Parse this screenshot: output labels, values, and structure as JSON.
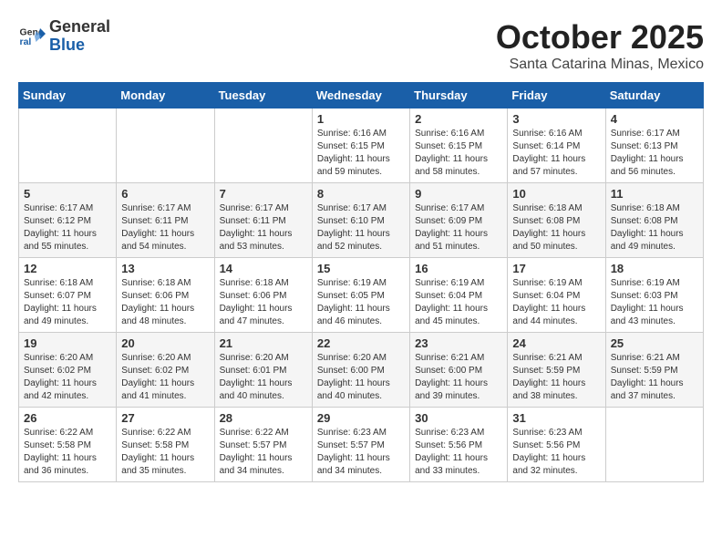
{
  "header": {
    "logo_general": "General",
    "logo_blue": "Blue",
    "month_title": "October 2025",
    "subtitle": "Santa Catarina Minas, Mexico"
  },
  "weekdays": [
    "Sunday",
    "Monday",
    "Tuesday",
    "Wednesday",
    "Thursday",
    "Friday",
    "Saturday"
  ],
  "weeks": [
    [
      {
        "day": "",
        "info": ""
      },
      {
        "day": "",
        "info": ""
      },
      {
        "day": "",
        "info": ""
      },
      {
        "day": "1",
        "info": "Sunrise: 6:16 AM\nSunset: 6:15 PM\nDaylight: 11 hours\nand 59 minutes."
      },
      {
        "day": "2",
        "info": "Sunrise: 6:16 AM\nSunset: 6:15 PM\nDaylight: 11 hours\nand 58 minutes."
      },
      {
        "day": "3",
        "info": "Sunrise: 6:16 AM\nSunset: 6:14 PM\nDaylight: 11 hours\nand 57 minutes."
      },
      {
        "day": "4",
        "info": "Sunrise: 6:17 AM\nSunset: 6:13 PM\nDaylight: 11 hours\nand 56 minutes."
      }
    ],
    [
      {
        "day": "5",
        "info": "Sunrise: 6:17 AM\nSunset: 6:12 PM\nDaylight: 11 hours\nand 55 minutes."
      },
      {
        "day": "6",
        "info": "Sunrise: 6:17 AM\nSunset: 6:11 PM\nDaylight: 11 hours\nand 54 minutes."
      },
      {
        "day": "7",
        "info": "Sunrise: 6:17 AM\nSunset: 6:11 PM\nDaylight: 11 hours\nand 53 minutes."
      },
      {
        "day": "8",
        "info": "Sunrise: 6:17 AM\nSunset: 6:10 PM\nDaylight: 11 hours\nand 52 minutes."
      },
      {
        "day": "9",
        "info": "Sunrise: 6:17 AM\nSunset: 6:09 PM\nDaylight: 11 hours\nand 51 minutes."
      },
      {
        "day": "10",
        "info": "Sunrise: 6:18 AM\nSunset: 6:08 PM\nDaylight: 11 hours\nand 50 minutes."
      },
      {
        "day": "11",
        "info": "Sunrise: 6:18 AM\nSunset: 6:08 PM\nDaylight: 11 hours\nand 49 minutes."
      }
    ],
    [
      {
        "day": "12",
        "info": "Sunrise: 6:18 AM\nSunset: 6:07 PM\nDaylight: 11 hours\nand 49 minutes."
      },
      {
        "day": "13",
        "info": "Sunrise: 6:18 AM\nSunset: 6:06 PM\nDaylight: 11 hours\nand 48 minutes."
      },
      {
        "day": "14",
        "info": "Sunrise: 6:18 AM\nSunset: 6:06 PM\nDaylight: 11 hours\nand 47 minutes."
      },
      {
        "day": "15",
        "info": "Sunrise: 6:19 AM\nSunset: 6:05 PM\nDaylight: 11 hours\nand 46 minutes."
      },
      {
        "day": "16",
        "info": "Sunrise: 6:19 AM\nSunset: 6:04 PM\nDaylight: 11 hours\nand 45 minutes."
      },
      {
        "day": "17",
        "info": "Sunrise: 6:19 AM\nSunset: 6:04 PM\nDaylight: 11 hours\nand 44 minutes."
      },
      {
        "day": "18",
        "info": "Sunrise: 6:19 AM\nSunset: 6:03 PM\nDaylight: 11 hours\nand 43 minutes."
      }
    ],
    [
      {
        "day": "19",
        "info": "Sunrise: 6:20 AM\nSunset: 6:02 PM\nDaylight: 11 hours\nand 42 minutes."
      },
      {
        "day": "20",
        "info": "Sunrise: 6:20 AM\nSunset: 6:02 PM\nDaylight: 11 hours\nand 41 minutes."
      },
      {
        "day": "21",
        "info": "Sunrise: 6:20 AM\nSunset: 6:01 PM\nDaylight: 11 hours\nand 40 minutes."
      },
      {
        "day": "22",
        "info": "Sunrise: 6:20 AM\nSunset: 6:00 PM\nDaylight: 11 hours\nand 40 minutes."
      },
      {
        "day": "23",
        "info": "Sunrise: 6:21 AM\nSunset: 6:00 PM\nDaylight: 11 hours\nand 39 minutes."
      },
      {
        "day": "24",
        "info": "Sunrise: 6:21 AM\nSunset: 5:59 PM\nDaylight: 11 hours\nand 38 minutes."
      },
      {
        "day": "25",
        "info": "Sunrise: 6:21 AM\nSunset: 5:59 PM\nDaylight: 11 hours\nand 37 minutes."
      }
    ],
    [
      {
        "day": "26",
        "info": "Sunrise: 6:22 AM\nSunset: 5:58 PM\nDaylight: 11 hours\nand 36 minutes."
      },
      {
        "day": "27",
        "info": "Sunrise: 6:22 AM\nSunset: 5:58 PM\nDaylight: 11 hours\nand 35 minutes."
      },
      {
        "day": "28",
        "info": "Sunrise: 6:22 AM\nSunset: 5:57 PM\nDaylight: 11 hours\nand 34 minutes."
      },
      {
        "day": "29",
        "info": "Sunrise: 6:23 AM\nSunset: 5:57 PM\nDaylight: 11 hours\nand 34 minutes."
      },
      {
        "day": "30",
        "info": "Sunrise: 6:23 AM\nSunset: 5:56 PM\nDaylight: 11 hours\nand 33 minutes."
      },
      {
        "day": "31",
        "info": "Sunrise: 6:23 AM\nSunset: 5:56 PM\nDaylight: 11 hours\nand 32 minutes."
      },
      {
        "day": "",
        "info": ""
      }
    ]
  ]
}
